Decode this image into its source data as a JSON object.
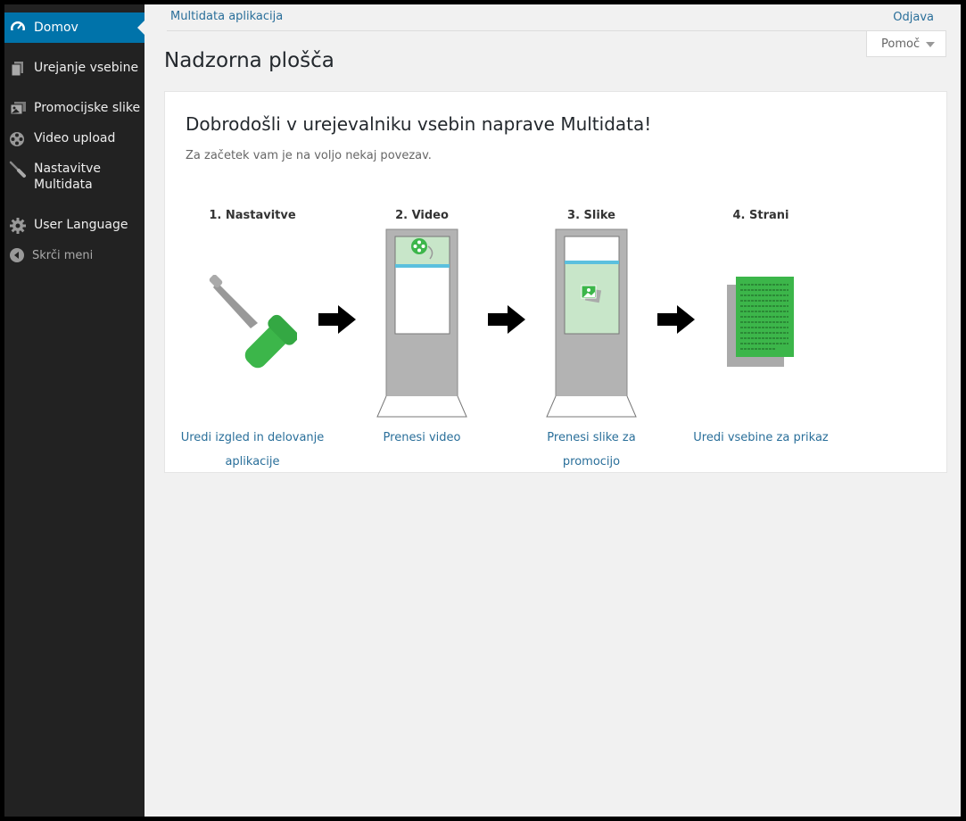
{
  "sidebar": {
    "items": [
      {
        "label": "Domov",
        "icon": "dashboard-icon",
        "active": true
      },
      {
        "label": "Urejanje vsebine",
        "icon": "pages-icon"
      },
      {
        "label": "Promocijske slike",
        "icon": "images-icon"
      },
      {
        "label": "Video upload",
        "icon": "video-reel-icon"
      },
      {
        "label": "Nastavitve Multidata",
        "icon": "screwdriver-icon"
      },
      {
        "label": "User Language",
        "icon": "gear-icon"
      }
    ],
    "collapse_label": "Skrči meni"
  },
  "topbar": {
    "breadcrumb": "Multidata aplikacija",
    "logout": "Odjava",
    "help": "Pomoč"
  },
  "page_title": "Nadzorna plošča",
  "welcome": {
    "title": "Dobrodošli v urejevalniku vsebin naprave Multidata!",
    "subtitle": "Za začetek vam je na voljo nekaj povezav.",
    "steps": [
      {
        "title": "1. Nastavitve",
        "link": "Uredi izgled in delovanje aplikacije"
      },
      {
        "title": "2. Video",
        "link": "Prenesi video"
      },
      {
        "title": "3. Slike",
        "link": "Prenesi slike za promocijo"
      },
      {
        "title": "4. Strani",
        "link": "Uredi vsebine za prikaz"
      }
    ]
  },
  "colors": {
    "sidebar_bg": "#222222",
    "active_bg": "#0073aa",
    "link": "#2a6f9a",
    "accent_green": "#3cb64a"
  }
}
